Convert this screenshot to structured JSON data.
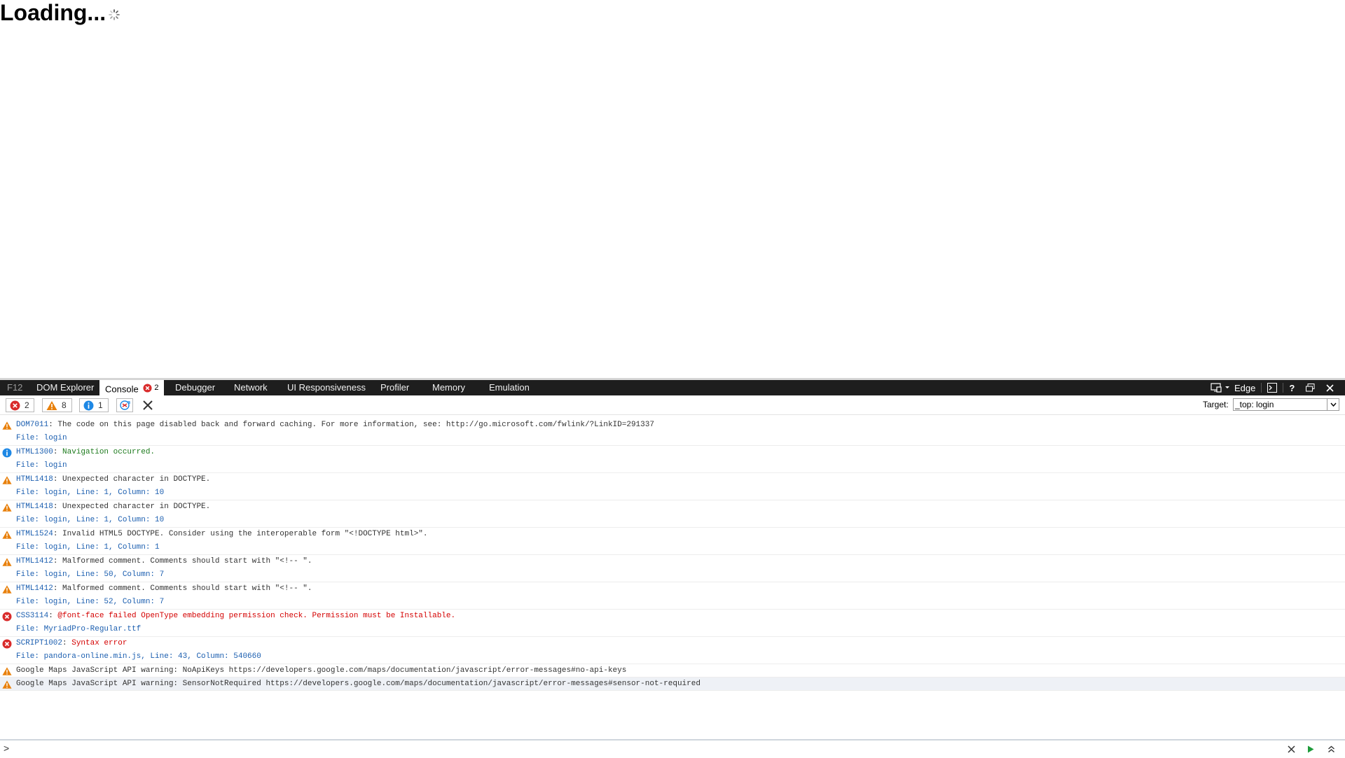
{
  "page": {
    "loading_text": "Loading..."
  },
  "devtools": {
    "tabs": [
      {
        "label": "F12"
      },
      {
        "label": "DOM Explorer"
      },
      {
        "label": "Console",
        "badge_count": "2"
      },
      {
        "label": "Debugger"
      },
      {
        "label": "Network"
      },
      {
        "label": "UI Responsiveness"
      },
      {
        "label": "Profiler"
      },
      {
        "label": "Memory"
      },
      {
        "label": "Emulation"
      }
    ],
    "mode_label": "Edge",
    "help_label": "?"
  },
  "toolbar": {
    "errors_count": "2",
    "warnings_count": "8",
    "info_count": "1",
    "target_label": "Target:",
    "target_value": "_top: login"
  },
  "messages": [
    {
      "type": "warning",
      "code": "DOM7011",
      "text": "The code on this page disabled back and forward caching. For more information, see: http://go.microsoft.com/fwlink/?LinkID=291337",
      "file": "File: login"
    },
    {
      "type": "info",
      "code": "HTML1300",
      "text": "Navigation occurred.",
      "file": "File: login"
    },
    {
      "type": "warning",
      "code": "HTML1418",
      "text": "Unexpected character in DOCTYPE.",
      "file": "File: login, Line: 1, Column: 10"
    },
    {
      "type": "warning",
      "code": "HTML1418",
      "text": "Unexpected character in DOCTYPE.",
      "file": "File: login, Line: 1, Column: 10"
    },
    {
      "type": "warning",
      "code": "HTML1524",
      "text": "Invalid HTML5 DOCTYPE. Consider using the interoperable form \"<!DOCTYPE html>\".",
      "file": "File: login, Line: 1, Column: 1"
    },
    {
      "type": "warning",
      "code": "HTML1412",
      "text": "Malformed comment. Comments should start with \"<!-- \".",
      "file": "File: login, Line: 50, Column: 7"
    },
    {
      "type": "warning",
      "code": "HTML1412",
      "text": "Malformed comment. Comments should start with \"<!-- \".",
      "file": "File: login, Line: 52, Column: 7"
    },
    {
      "type": "error",
      "code": "CSS3114",
      "text": "@font-face failed OpenType embedding permission check. Permission must be Installable.",
      "file": "File: MyriadPro-Regular.ttf"
    },
    {
      "type": "error",
      "code": "SCRIPT1002",
      "text": "Syntax error",
      "file": "File: pandora-online.min.js, Line: 43, Column: 540660"
    },
    {
      "type": "warning",
      "code": "",
      "text": "Google Maps JavaScript API warning: NoApiKeys https://developers.google.com/maps/documentation/javascript/error-messages#no-api-keys",
      "file": ""
    },
    {
      "type": "warning",
      "code": "",
      "text": "Google Maps JavaScript API warning: SensorNotRequired https://developers.google.com/maps/documentation/javascript/error-messages#sensor-not-required",
      "file": ""
    }
  ],
  "cmdline": {
    "prompt": ">"
  },
  "icons": {
    "warning": "warning-icon",
    "info": "info-icon",
    "error": "error-icon",
    "warning_color": "#e8800c",
    "info_color": "#1e88e5",
    "error_color": "#d92b2b"
  }
}
